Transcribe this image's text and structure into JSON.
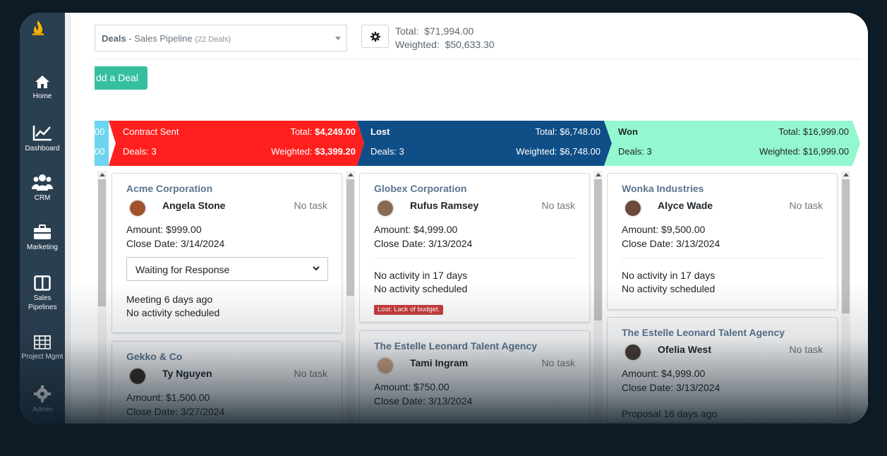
{
  "sidebar": {
    "items": [
      {
        "label": "Home",
        "icon": "home-icon"
      },
      {
        "label": "Dashboard",
        "icon": "chart-line-icon"
      },
      {
        "label": "CRM",
        "icon": "users-icon"
      },
      {
        "label": "Marketing",
        "icon": "briefcase-icon"
      },
      {
        "label": "Sales Pipelines",
        "icon": "columns-icon"
      },
      {
        "label": "Project Mgmt",
        "icon": "table-icon"
      },
      {
        "label": "Admin",
        "icon": "gear-icon"
      }
    ]
  },
  "header": {
    "pipeline_bold": "Deals",
    "pipeline_name": " - Sales Pipeline ",
    "pipeline_count": "(22 Deals)",
    "total_label": "Total:",
    "total_value": "$71,994.00",
    "weighted_label": "Weighted:",
    "weighted_value": "$50,633.30",
    "add_deal_label": "dd a Deal"
  },
  "stages": [
    {
      "name": "",
      "total": "00",
      "deals": "00",
      "color": "#6dd5ef"
    },
    {
      "name": "Contract Sent",
      "total_label": "Total:",
      "total": "$4,249.00",
      "deals": "Deals: 3",
      "weighted_label": "Weighted:",
      "weighted": "$3,399.20",
      "color": "#ff1f1f"
    },
    {
      "name": "Lost",
      "total_label": "Total:",
      "total": "$6,748.00",
      "deals": "Deals: 3",
      "weighted_label": "Weighted:",
      "weighted": "$6,748.00",
      "color": "#0f4e86"
    },
    {
      "name": "Won",
      "total_label": "Total:",
      "total": "$16,999.00",
      "deals": "Deals: 3",
      "weighted_label": "Weighted:",
      "weighted": "$16,999.00",
      "color": "#93f7cf"
    }
  ],
  "columns": [
    {
      "cards": [
        {
          "company": "Acme Corporation",
          "person": "Angela Stone",
          "task": "No task",
          "amount": "Amount: $999.00",
          "close": "Close Date: 3/14/2024",
          "status": "Waiting for Response",
          "activity1": "Meeting 6 days ago",
          "activity2": "No activity scheduled",
          "avatar_color": "#a0522d"
        },
        {
          "company": "Gekko & Co",
          "person": "Ty Nguyen",
          "task": "No task",
          "amount": "Amount: $1,500.00",
          "close": "Close Date: 3/27/2024",
          "avatar_color": "#3a2a20"
        }
      ]
    },
    {
      "cards": [
        {
          "company": "Globex Corporation",
          "person": "Rufus Ramsey",
          "task": "No task",
          "amount": "Amount: $4,999.00",
          "close": "Close Date: 3/13/2024",
          "activity1": "No activity in 17 days",
          "activity2": "No activity scheduled",
          "tag": "Lost: Lack of budget.",
          "avatar_color": "#8a6a52"
        },
        {
          "company": "The Estelle Leonard Talent Agency",
          "person": "Tami Ingram",
          "task": "No task",
          "amount": "Amount: $750.00",
          "close": "Close Date: 3/13/2024",
          "avatar_color": "#d8a88a"
        }
      ]
    },
    {
      "cards": [
        {
          "company": "Wonka Industries",
          "person": "Alyce Wade",
          "task": "No task",
          "amount": "Amount: $9,500.00",
          "close": "Close Date: 3/13/2024",
          "activity1": "No activity in 17 days",
          "activity2": "No activity scheduled",
          "avatar_color": "#6b4a3a"
        },
        {
          "company": "The Estelle Leonard Talent Agency",
          "person": "Ofelia West",
          "task": "No task",
          "amount": "Amount: $4,999.00",
          "close": "Close Date: 3/13/2024",
          "activity1": "Proposal 16 days ago",
          "avatar_color": "#4a3a34"
        }
      ]
    }
  ]
}
